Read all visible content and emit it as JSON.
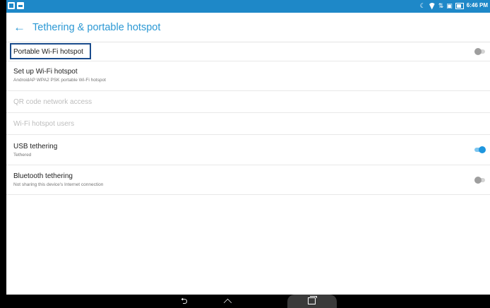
{
  "status_bar": {
    "time": "6:46 PM",
    "left_icons": [
      "usb-icon",
      "image-icon"
    ],
    "right_icons": [
      "moon-icon",
      "wifi-icon",
      "data-transfer-icon",
      "sd-card-icon",
      "battery-charging-icon"
    ],
    "background_color": "#1e88c8"
  },
  "toolbar": {
    "back_icon": "arrow-left-icon",
    "title": "Tethering & portable hotspot",
    "accent_color": "#2b98d4"
  },
  "settings": {
    "portable_wifi_hotspot": {
      "label": "Portable Wi-Fi hotspot",
      "toggle_on": false
    },
    "setup_wifi_hotspot": {
      "label": "Set up Wi-Fi hotspot",
      "summary": "AndroidAP WPA2 PSK portable Wi-Fi hotspot"
    },
    "qr_code_access": {
      "label": "QR code network access",
      "enabled": false
    },
    "hotspot_users": {
      "label": "Wi-Fi hotspot users",
      "enabled": false
    },
    "usb_tethering": {
      "label": "USB tethering",
      "summary": "Tethered",
      "toggle_on": true
    },
    "bluetooth_tethering": {
      "label": "Bluetooth tethering",
      "summary": "Not sharing this device's Internet connection",
      "toggle_on": false
    }
  },
  "nav_bar": {
    "icons": [
      "back-icon",
      "home-icon",
      "recents-icon"
    ]
  },
  "highlight_color": "#1a4b8c"
}
